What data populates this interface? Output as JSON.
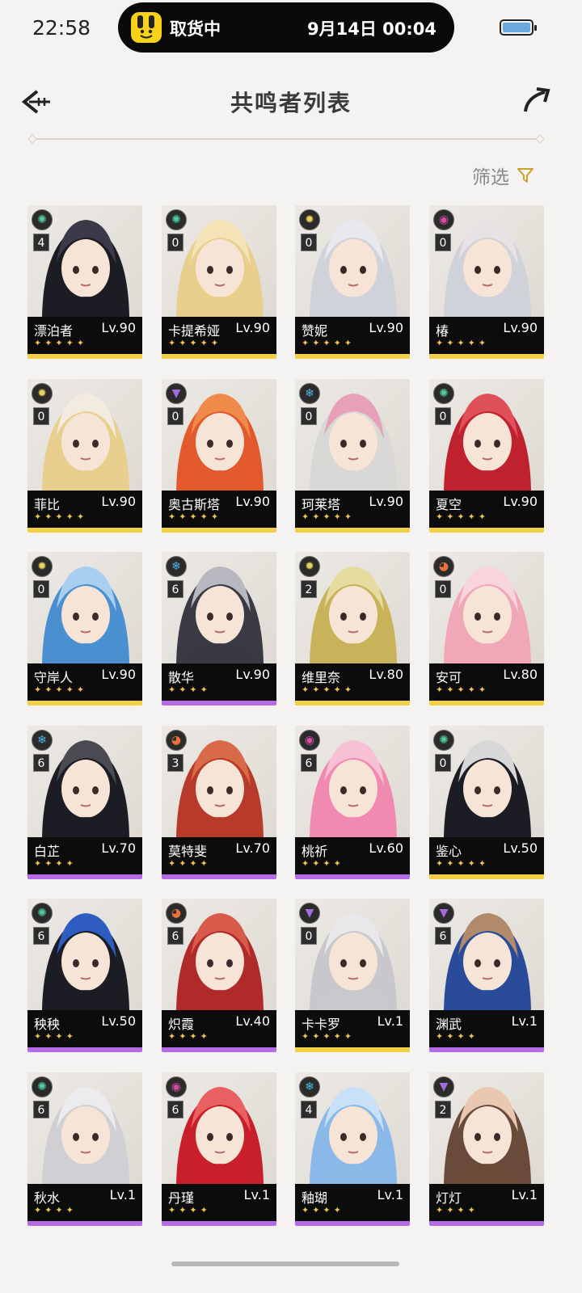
{
  "status_bar": {
    "time": "22:58",
    "island_status": "取货中",
    "island_time": "9月14日 00:04"
  },
  "header": {
    "title": "共鸣者列表"
  },
  "filter": {
    "label": "筛选"
  },
  "colors": {
    "five_star": "#f2d046",
    "four_star": "#b46ce6"
  },
  "characters": [
    {
      "name": "漂泊者",
      "level": "Lv.90",
      "chain": "4",
      "element": "aero-icon",
      "stars": 5,
      "rarity_color": "#f2d046"
    },
    {
      "name": "卡提希娅",
      "level": "Lv.90",
      "chain": "0",
      "element": "aero-icon",
      "stars": 5,
      "rarity_color": "#f2d046"
    },
    {
      "name": "赞妮",
      "level": "Lv.90",
      "chain": "0",
      "element": "spectro-icon",
      "stars": 5,
      "rarity_color": "#f2d046"
    },
    {
      "name": "椿",
      "level": "Lv.90",
      "chain": "0",
      "element": "havoc-icon",
      "stars": 5,
      "rarity_color": "#f2d046"
    },
    {
      "name": "菲比",
      "level": "Lv.90",
      "chain": "0",
      "element": "spectro-icon",
      "stars": 5,
      "rarity_color": "#f2d046"
    },
    {
      "name": "奥古斯塔",
      "level": "Lv.90",
      "chain": "0",
      "element": "electro-icon",
      "stars": 5,
      "rarity_color": "#f2d046"
    },
    {
      "name": "珂莱塔",
      "level": "Lv.90",
      "chain": "0",
      "element": "glacio-icon",
      "stars": 5,
      "rarity_color": "#f2d046"
    },
    {
      "name": "夏空",
      "level": "Lv.90",
      "chain": "0",
      "element": "aero-icon",
      "stars": 5,
      "rarity_color": "#f2d046"
    },
    {
      "name": "守岸人",
      "level": "Lv.90",
      "chain": "0",
      "element": "spectro-icon",
      "stars": 5,
      "rarity_color": "#f2d046"
    },
    {
      "name": "散华",
      "level": "Lv.90",
      "chain": "6",
      "element": "glacio-icon",
      "stars": 4,
      "rarity_color": "#b46ce6"
    },
    {
      "name": "维里奈",
      "level": "Lv.80",
      "chain": "2",
      "element": "spectro-icon",
      "stars": 5,
      "rarity_color": "#f2d046"
    },
    {
      "name": "安可",
      "level": "Lv.80",
      "chain": "0",
      "element": "fusion-icon",
      "stars": 5,
      "rarity_color": "#f2d046"
    },
    {
      "name": "白芷",
      "level": "Lv.70",
      "chain": "6",
      "element": "glacio-icon",
      "stars": 4,
      "rarity_color": "#b46ce6"
    },
    {
      "name": "莫特斐",
      "level": "Lv.70",
      "chain": "3",
      "element": "fusion-icon",
      "stars": 4,
      "rarity_color": "#b46ce6"
    },
    {
      "name": "桃祈",
      "level": "Lv.60",
      "chain": "6",
      "element": "havoc-icon",
      "stars": 4,
      "rarity_color": "#b46ce6"
    },
    {
      "name": "鉴心",
      "level": "Lv.50",
      "chain": "0",
      "element": "aero-icon",
      "stars": 5,
      "rarity_color": "#f2d046"
    },
    {
      "name": "秧秧",
      "level": "Lv.50",
      "chain": "6",
      "element": "aero-icon",
      "stars": 4,
      "rarity_color": "#b46ce6"
    },
    {
      "name": "炽霞",
      "level": "Lv.40",
      "chain": "6",
      "element": "fusion-icon",
      "stars": 4,
      "rarity_color": "#b46ce6"
    },
    {
      "name": "卡卡罗",
      "level": "Lv.1",
      "chain": "0",
      "element": "electro-icon",
      "stars": 5,
      "rarity_color": "#f2d046"
    },
    {
      "name": "渊武",
      "level": "Lv.1",
      "chain": "6",
      "element": "electro-icon",
      "stars": 4,
      "rarity_color": "#b46ce6"
    },
    {
      "name": "秋水",
      "level": "Lv.1",
      "chain": "6",
      "element": "aero-icon",
      "stars": 4,
      "rarity_color": "#b46ce6"
    },
    {
      "name": "丹瑾",
      "level": "Lv.1",
      "chain": "6",
      "element": "havoc-icon",
      "stars": 4,
      "rarity_color": "#b46ce6"
    },
    {
      "name": "釉瑚",
      "level": "Lv.1",
      "chain": "4",
      "element": "glacio-icon",
      "stars": 4,
      "rarity_color": "#b46ce6"
    },
    {
      "name": "灯灯",
      "level": "Lv.1",
      "chain": "2",
      "element": "electro-icon",
      "stars": 4,
      "rarity_color": "#b46ce6"
    }
  ]
}
